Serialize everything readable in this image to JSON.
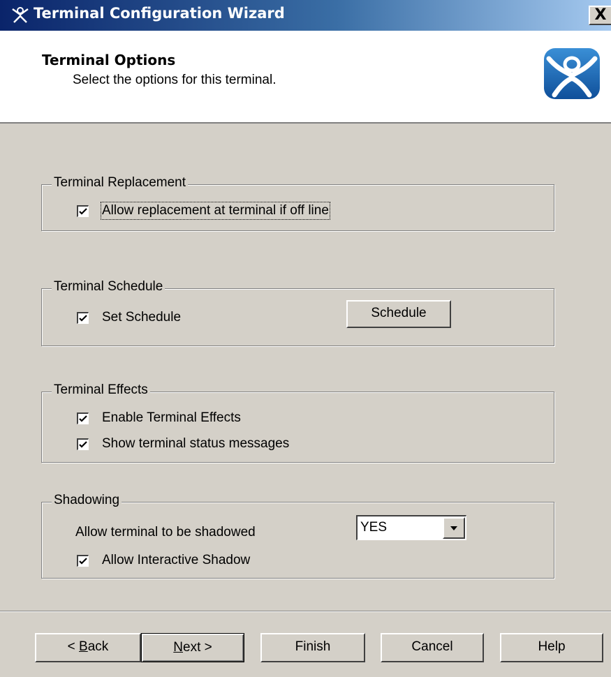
{
  "window": {
    "title": "Terminal Configuration Wizard",
    "close_glyph": "X",
    "title_icon": "thinmanager-icon"
  },
  "header": {
    "title": "Terminal Options",
    "subtitle": "Select the options for this terminal.",
    "logo_icon": "thinmanager-logo-icon"
  },
  "groups": {
    "replacement": {
      "legend": "Terminal Replacement",
      "allow_replacement": {
        "label": "Allow replacement at terminal if off line",
        "checked": true
      }
    },
    "schedule": {
      "legend": "Terminal Schedule",
      "set_schedule": {
        "label": "Set Schedule",
        "checked": true
      },
      "schedule_button": "Schedule"
    },
    "effects": {
      "legend": "Terminal Effects",
      "enable_effects": {
        "label": "Enable Terminal Effects",
        "checked": true
      },
      "show_status": {
        "label": "Show terminal status messages",
        "checked": true
      }
    },
    "shadowing": {
      "legend": "Shadowing",
      "allow_shadow_label": "Allow terminal to be shadowed",
      "allow_shadow_value": "YES",
      "interactive_shadow": {
        "label": "Allow Interactive Shadow",
        "checked": true
      }
    }
  },
  "buttons": {
    "back_prefix": "< ",
    "back_mnemonic": "B",
    "back_rest": "ack",
    "next_mnemonic": "N",
    "next_rest": "ext >",
    "finish": "Finish",
    "cancel": "Cancel",
    "help": "Help"
  }
}
